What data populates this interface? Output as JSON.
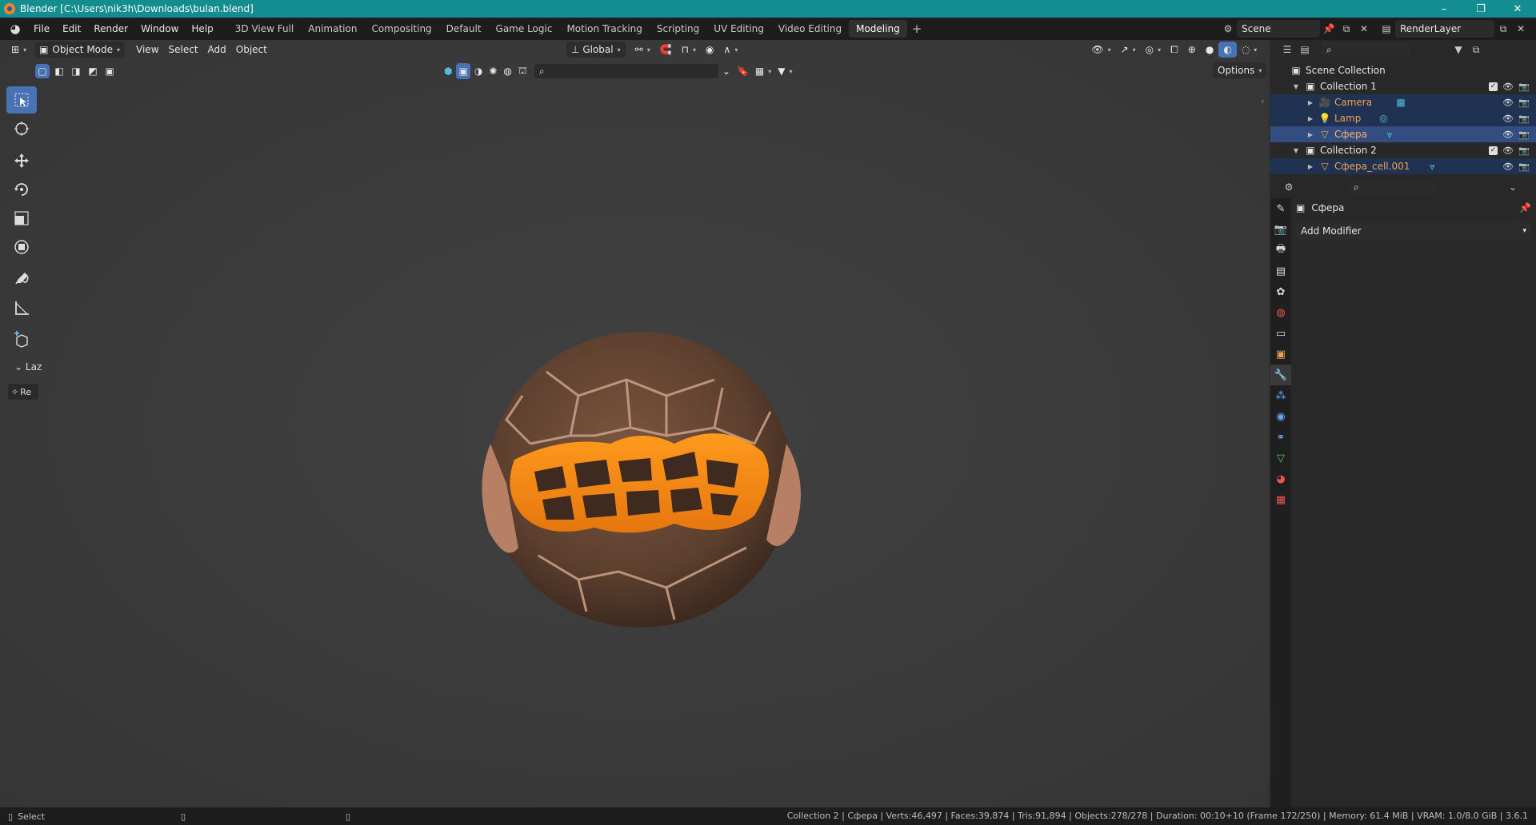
{
  "window": {
    "title": "Blender [C:\\Users\\nik3h\\Downloads\\bulan.blend]",
    "minimize": "–",
    "maximize": "❐",
    "close": "✕"
  },
  "menu": [
    "File",
    "Edit",
    "Render",
    "Window",
    "Help"
  ],
  "workspaces": [
    "3D View Full",
    "Animation",
    "Compositing",
    "Default",
    "Game Logic",
    "Motion Tracking",
    "Scripting",
    "UV Editing",
    "Video Editing",
    "Modeling"
  ],
  "active_workspace": "Modeling",
  "scene": {
    "name": "Scene",
    "render_layer": "RenderLayer"
  },
  "viewport": {
    "mode": "Object Mode",
    "menus": [
      "View",
      "Select",
      "Add",
      "Object"
    ],
    "orientation": "Global",
    "options_label": "Options"
  },
  "last_operator": {
    "panel": "Laz",
    "button": "Re"
  },
  "outliner": {
    "root": "Scene Collection",
    "rows": [
      {
        "label": "Collection 1",
        "type": "collection"
      },
      {
        "label": "Camera",
        "type": "object"
      },
      {
        "label": "Lamp",
        "type": "object"
      },
      {
        "label": "Сфера",
        "type": "object"
      },
      {
        "label": "Collection 2",
        "type": "collection"
      },
      {
        "label": "Сфера_cell.001",
        "type": "object"
      }
    ]
  },
  "properties": {
    "object_name": "Сфера",
    "add_modifier": "Add Modifier"
  },
  "status": {
    "left": "Select",
    "right": "Collection 2 | Сфера | Verts:46,497 | Faces:39,874 | Tris:91,894 | Objects:278/278 | Duration: 00:10+10 (Frame 172/250) | Memory: 61.4 MiB | VRAM: 1.0/8.0 GiB | 3.6.1"
  },
  "colors": {
    "accent": "#4772b3",
    "titlebar": "#138d8f",
    "lava": "#f08a1c",
    "rock": "#6e4a34"
  }
}
